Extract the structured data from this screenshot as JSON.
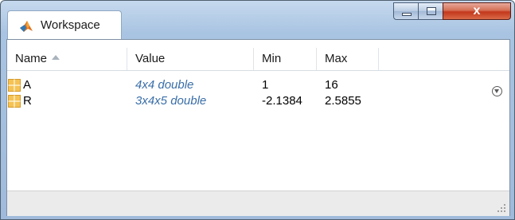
{
  "window": {
    "title": "Workspace",
    "icon": "matlab-logo-icon",
    "controls": {
      "minimize_icon": "minimize-icon",
      "maximize_icon": "maximize-icon",
      "close_label": "x"
    }
  },
  "table": {
    "columns": [
      "Name",
      "Value",
      "Min",
      "Max"
    ],
    "sorted_by": "Name",
    "sort_direction": "ascending",
    "rows": [
      {
        "name": "A",
        "value": "4x4 double",
        "min": "1",
        "max": "16",
        "icon": "matrix-variable-icon"
      },
      {
        "name": "R",
        "value": "3x4x5 double",
        "min": "-2.1384",
        "max": "2.5855",
        "icon": "matrix-variable-icon"
      }
    ]
  },
  "colors": {
    "value_link": "#3a6ea8",
    "frame": "#a9c4e2",
    "close_button": "#c3371c"
  }
}
